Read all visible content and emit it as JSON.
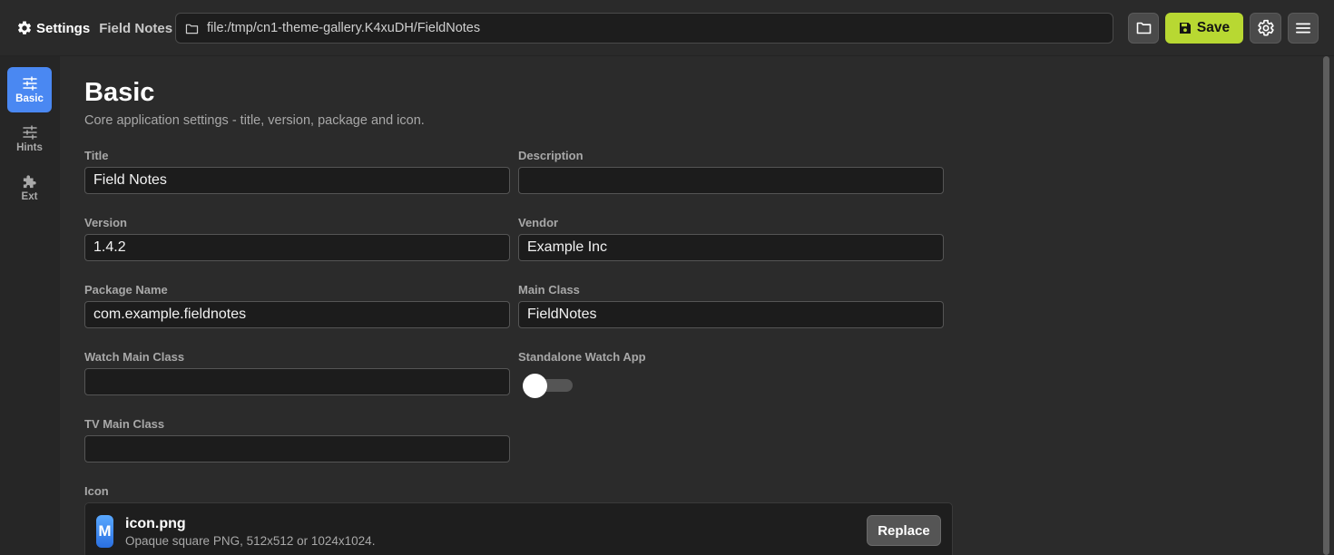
{
  "header": {
    "title": "Settings",
    "project": "Field Notes",
    "path": "file:/tmp/cn1-theme-gallery.K4xuDH/FieldNotes",
    "save_label": "Save"
  },
  "sidebar": {
    "items": [
      {
        "label": "Basic",
        "icon": "sliders-icon",
        "active": true
      },
      {
        "label": "Hints",
        "icon": "sliders-icon",
        "active": false
      },
      {
        "label": "Ext",
        "icon": "puzzle-icon",
        "active": false
      }
    ]
  },
  "main": {
    "title": "Basic",
    "subtitle": "Core application settings - title, version, package and icon.",
    "fields": {
      "title": {
        "label": "Title",
        "value": "Field Notes"
      },
      "description": {
        "label": "Description",
        "value": ""
      },
      "version": {
        "label": "Version",
        "value": "1.4.2"
      },
      "vendor": {
        "label": "Vendor",
        "value": "Example Inc"
      },
      "package_name": {
        "label": "Package Name",
        "value": "com.example.fieldnotes"
      },
      "main_class": {
        "label": "Main Class",
        "value": "FieldNotes"
      },
      "watch_main_class": {
        "label": "Watch Main Class",
        "value": ""
      },
      "standalone_watch_app": {
        "label": "Standalone Watch App",
        "enabled": false
      },
      "tv_main_class": {
        "label": "TV Main Class",
        "value": ""
      }
    },
    "icon_section": {
      "label": "Icon",
      "icon_letter": "M",
      "file_name": "icon.png",
      "hint": "Opaque square PNG, 512x512 or 1024x1024.",
      "replace_label": "Replace"
    }
  },
  "colors": {
    "background": "#2b2b2b",
    "accent_blue": "#4a88f2",
    "save_green": "#b8d832"
  }
}
